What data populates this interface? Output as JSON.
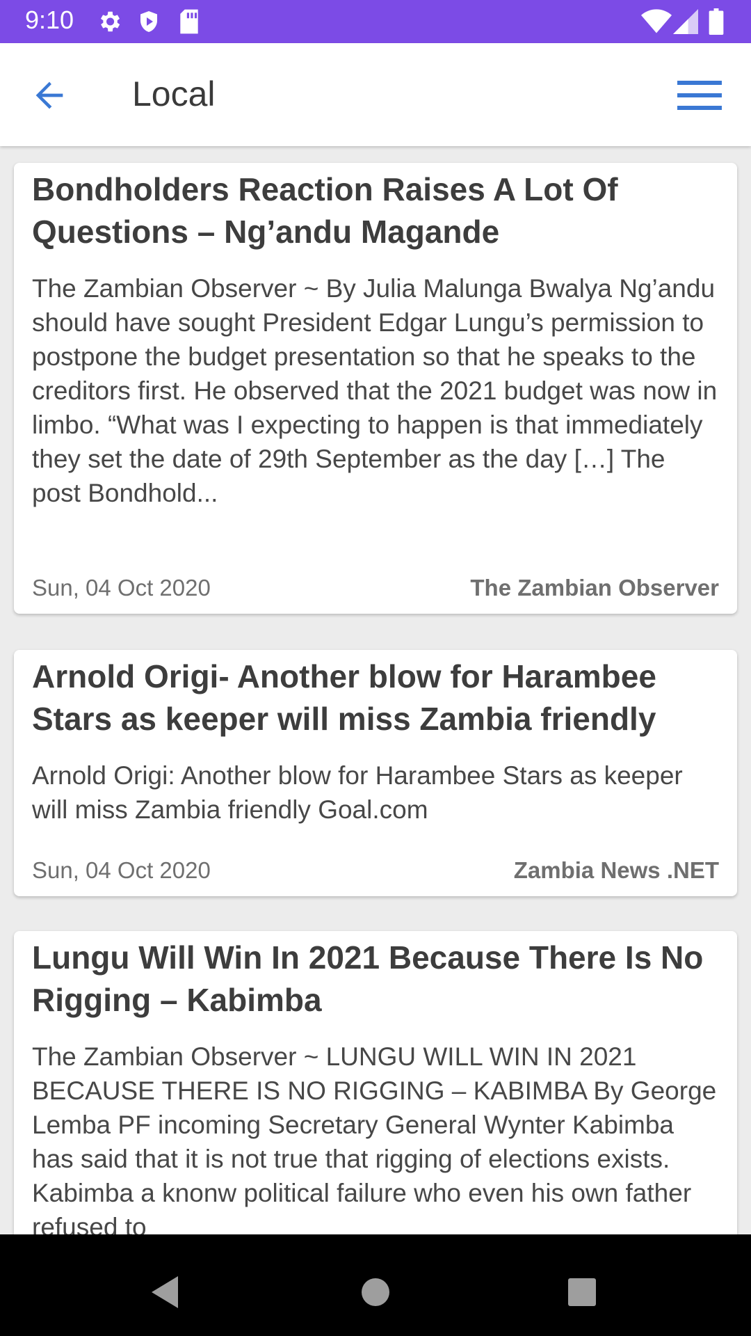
{
  "status_bar": {
    "time": "9:10",
    "icons": [
      "settings-icon",
      "shield-icon",
      "sd-card-icon",
      "wifi-icon",
      "signal-icon",
      "battery-icon"
    ],
    "color": "#7c4be6"
  },
  "app_bar": {
    "title": "Local",
    "back_icon": "arrow-back-icon",
    "menu_icon": "hamburger-menu-icon",
    "accent": "#3a78d4"
  },
  "articles": [
    {
      "title": "Bondholders Reaction Raises A Lot Of Questions – Ng’andu Magande",
      "excerpt": "The Zambian Observer ~ By Julia Malunga Bwalya Ng’andu should have sought President Edgar Lungu’s permission to postpone the budget presentation so that he speaks to the creditors first. He observed that the 2021 budget was now in limbo. “What was I expecting to happen is that immediately they set the date of 29th September as the day […] The post Bondhold...",
      "date": "Sun, 04 Oct 2020",
      "source": "The Zambian Observer"
    },
    {
      "title": "Arnold Origi- Another blow for Harambee Stars as keeper will miss Zambia friendly",
      "excerpt": "Arnold Origi: Another blow for Harambee Stars as keeper will miss Zambia friendly Goal.com",
      "date": "Sun, 04 Oct 2020",
      "source": "Zambia News .NET"
    },
    {
      "title": "Lungu Will Win In 2021 Because There Is No Rigging – Kabimba",
      "excerpt": "The Zambian Observer ~ LUNGU WILL WIN IN 2021 BECAUSE THERE IS NO RIGGING – KABIMBA By George Lemba PF incoming Secretary General Wynter Kabimba has said that it is not true that rigging of elections exists. Kabimba a knonw political failure who even his own father refused to",
      "date": "",
      "source": ""
    }
  ],
  "nav_bar": {
    "buttons": [
      "back-triangle-icon",
      "home-circle-icon",
      "recents-square-icon"
    ]
  }
}
